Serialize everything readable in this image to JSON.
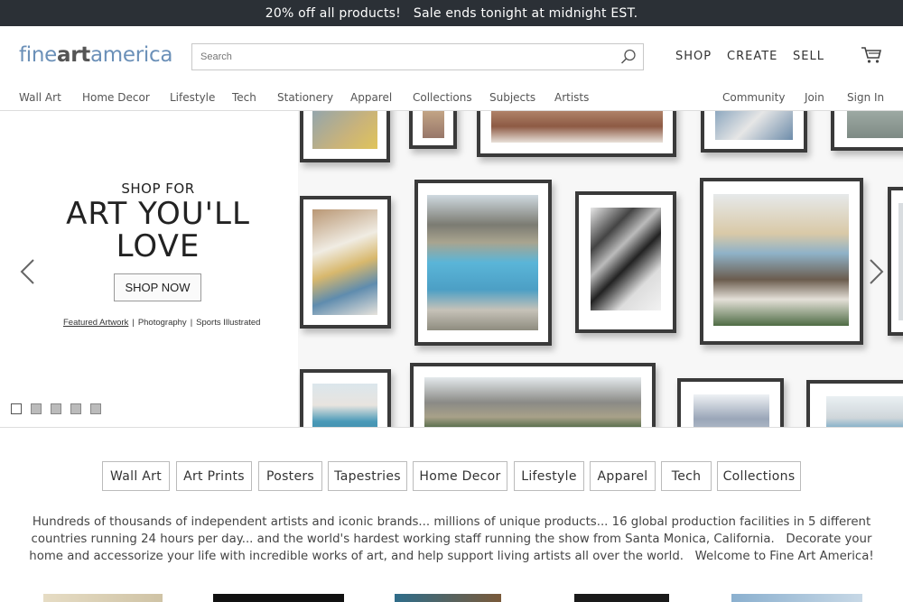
{
  "promo": {
    "text": "20% off all products!   Sale ends tonight at midnight EST."
  },
  "header": {
    "logo_parts": [
      "fine",
      "art",
      "america"
    ],
    "search_placeholder": "Search",
    "top_nav": [
      "SHOP",
      "CREATE",
      "SELL"
    ]
  },
  "category_nav": {
    "left": [
      "Wall Art",
      "Home Decor",
      "Lifestyle",
      "Tech",
      "Stationery",
      "Apparel",
      "Collections",
      "Subjects",
      "Artists"
    ],
    "right": [
      "Community",
      "Join",
      "Sign In"
    ]
  },
  "hero": {
    "kicker": "SHOP FOR",
    "headline_line1": "ART YOU'LL",
    "headline_line2": "LOVE",
    "cta": "SHOP NOW",
    "links": [
      "Featured Artwork",
      "Photography",
      "Sports Illustrated"
    ],
    "separator": "|",
    "slide_count": 5,
    "active_slide": 1
  },
  "category_pills": [
    "Wall Art",
    "Art Prints",
    "Posters",
    "Tapestries",
    "Home Decor",
    "Lifestyle",
    "Apparel",
    "Tech",
    "Collections"
  ],
  "intro_text": "Hundreds of thousands of independent artists and iconic brands... millions of unique products... 16 global production facilities in 5 different countries running 24 hours per day... and the world's hardest working staff running the show from Santa Monica, California.   Decorate your home and accessorize your life with incredible works of art, and help support living artists all over the world.   Welcome to Fine Art America!",
  "colors": {
    "promo_bg": "#2b3036",
    "logo_blue": "#6b90b8",
    "frame": "#3a3a3a"
  },
  "icons": [
    "search-icon",
    "cart-icon",
    "chevron-left-icon",
    "chevron-right-icon"
  ]
}
